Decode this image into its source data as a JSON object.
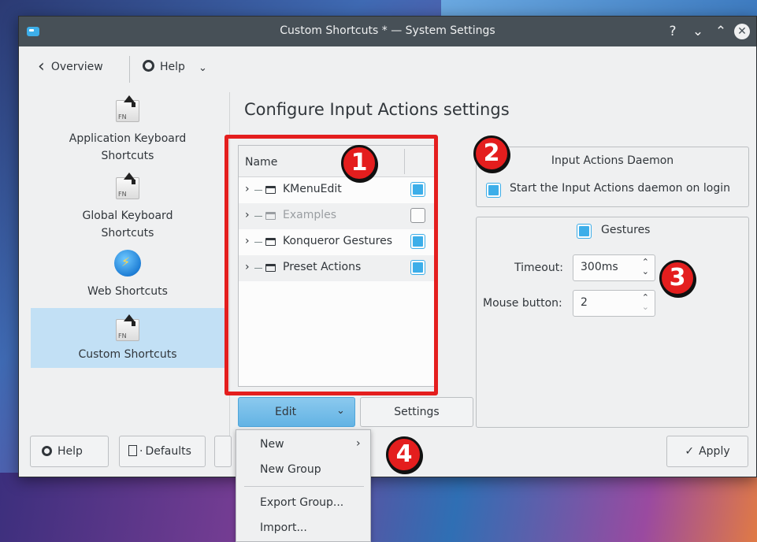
{
  "window": {
    "title": "Custom Shortcuts * — System Settings",
    "controls": {
      "help": "?",
      "minimize": "⌄",
      "maximize": "⌃",
      "close": "✕"
    }
  },
  "toolbar": {
    "overview_label": "Overview",
    "help_label": "Help"
  },
  "sidebar": {
    "items": [
      {
        "label": "Application Keyboard Shortcuts",
        "icon": "fn-key-icon"
      },
      {
        "label": "Global Keyboard Shortcuts",
        "icon": "fn-key-icon"
      },
      {
        "label": "Web Shortcuts",
        "icon": "globe-icon"
      },
      {
        "label": "Custom Shortcuts",
        "icon": "fn-key-icon",
        "selected": true
      }
    ]
  },
  "main": {
    "title": "Configure Input Actions settings",
    "tree": {
      "header": "Name",
      "rows": [
        {
          "label": "KMenuEdit",
          "checked": true,
          "disabled": false
        },
        {
          "label": "Examples",
          "checked": false,
          "disabled": true
        },
        {
          "label": "Konqueror Gestures",
          "checked": true,
          "disabled": false
        },
        {
          "label": "Preset Actions",
          "checked": true,
          "disabled": false
        }
      ]
    },
    "edit_button": "Edit",
    "settings_button": "Settings"
  },
  "daemon": {
    "title": "Input Actions Daemon",
    "start_label": "Start the Input Actions daemon on login",
    "start_checked": true
  },
  "gestures": {
    "label": "Gestures",
    "checked": true,
    "timeout_label": "Timeout:",
    "timeout_value": "300ms",
    "mouse_label": "Mouse button:",
    "mouse_value": "2"
  },
  "footer": {
    "help": "Help",
    "defaults": "Defaults",
    "apply": "Apply"
  },
  "menu": {
    "items": [
      "New",
      "New Group",
      "Export Group...",
      "Import..."
    ]
  },
  "annotations": [
    "1",
    "2",
    "3",
    "4"
  ],
  "colors": {
    "accent": "#3daee9",
    "highlight": "#e41e1e",
    "selection": "#c2e0f5",
    "titlebar": "#475057"
  }
}
